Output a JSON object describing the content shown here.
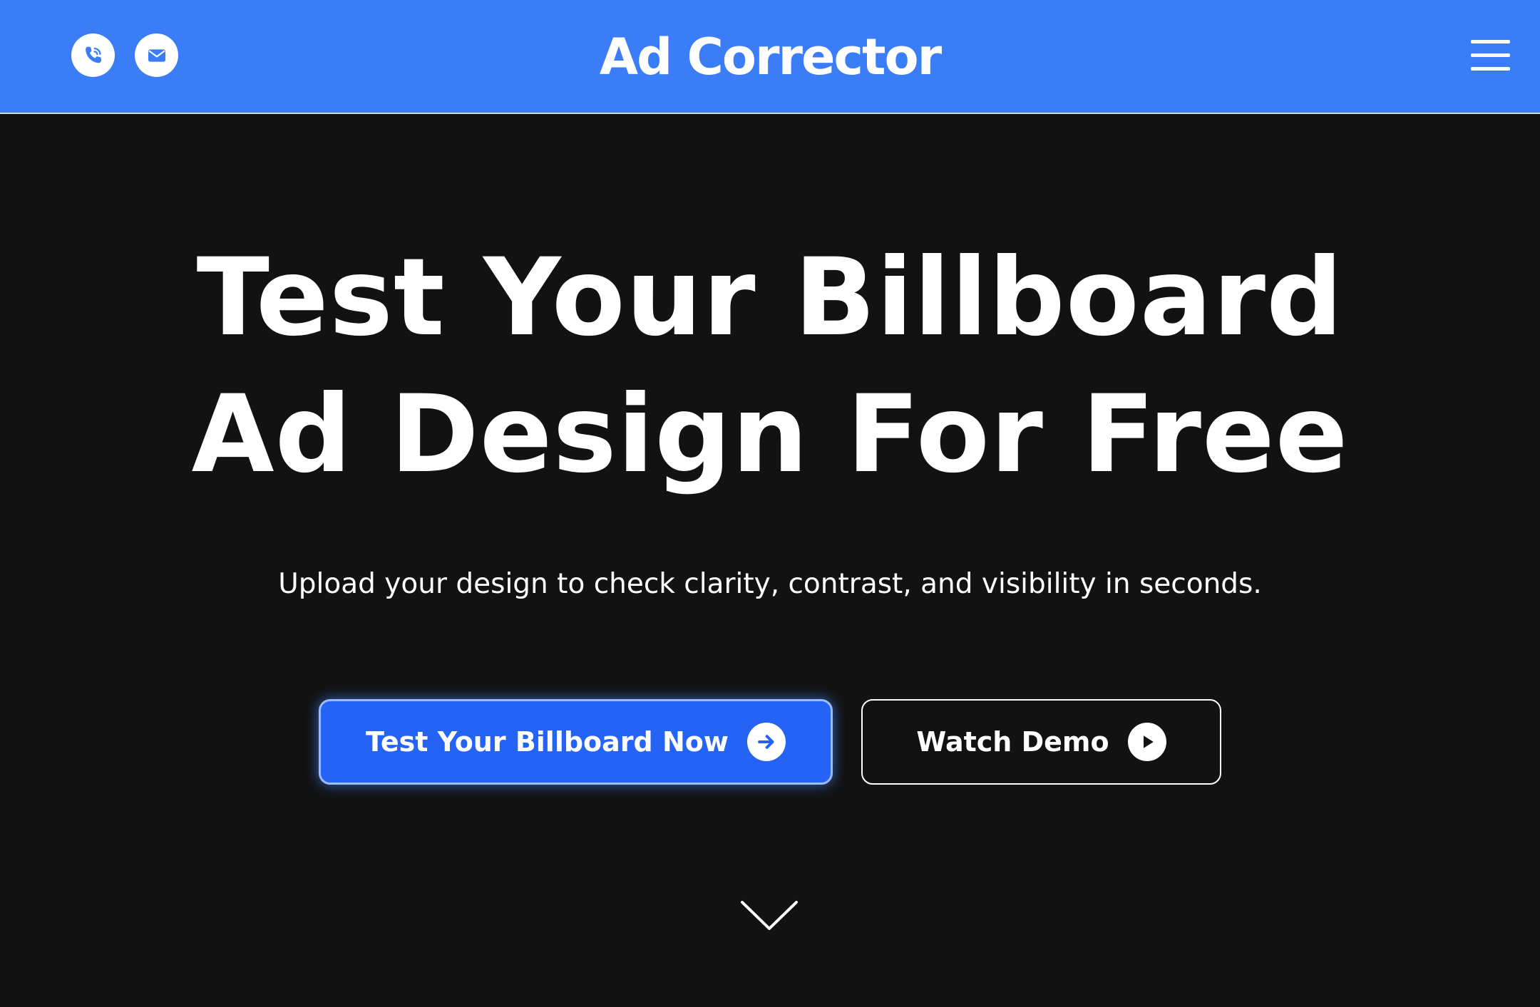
{
  "header": {
    "brand": "Ad Corrector",
    "icons": [
      "phone-icon",
      "mail-icon",
      "hamburger-menu-icon"
    ],
    "background_color": "#3a7df6"
  },
  "hero": {
    "headline_line1": "Test Your Billboard",
    "headline_line2": "Ad Design For Free",
    "subtitle": "Upload your design to check clarity, contrast, and visibility in seconds.",
    "primary_button_label": "Test Your Billboard Now",
    "primary_button_icon": "arrow-right-icon",
    "secondary_button_label": "Watch Demo",
    "secondary_button_icon": "play-icon",
    "scroll_icon": "chevron-down-icon",
    "background_color": "#121212",
    "primary_button_color": "#2563f5"
  }
}
